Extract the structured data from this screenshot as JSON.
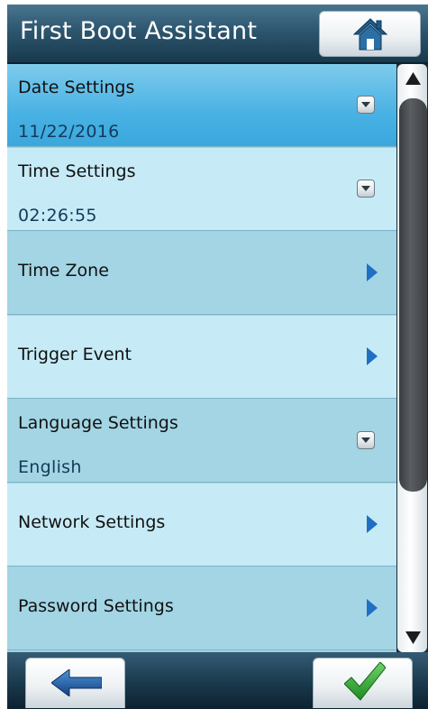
{
  "header": {
    "title": "First Boot Assistant",
    "home_icon": "home-icon"
  },
  "menu": {
    "items": [
      {
        "label": "Date Settings",
        "value": "11/22/2016",
        "control": "dropdown"
      },
      {
        "label": "Time Settings",
        "value": "02:26:55",
        "control": "dropdown"
      },
      {
        "label": "Time Zone",
        "control": "chevron"
      },
      {
        "label": "Trigger Event",
        "control": "chevron"
      },
      {
        "label": "Language Settings",
        "value": "English",
        "control": "dropdown"
      },
      {
        "label": "Network Settings",
        "control": "chevron"
      },
      {
        "label": "Password Settings",
        "control": "chevron"
      }
    ]
  },
  "footer": {
    "back_icon": "back-arrow-icon",
    "confirm_icon": "checkmark-icon"
  },
  "colors": {
    "selected_row": "#49b2e4",
    "light_row": "#c6ebf6",
    "dark_row": "#a3d5e4",
    "chevron": "#1f6fc4",
    "checkmark": "#2fa32f",
    "back_arrow": "#1b5fae"
  }
}
